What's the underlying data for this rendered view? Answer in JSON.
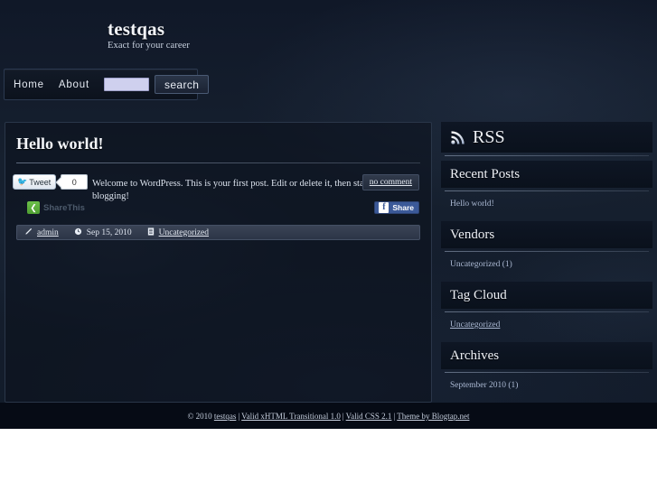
{
  "site": {
    "title": "testqas",
    "tagline": "Exact for your career"
  },
  "nav": {
    "items": [
      {
        "label": "Home"
      },
      {
        "label": "About"
      }
    ],
    "search": {
      "value": "",
      "placeholder": "",
      "button_label": "search"
    }
  },
  "post": {
    "title": "Hello world!",
    "excerpt": "Welcome to WordPress. This is your first post. Edit or delete it, then start blogging!",
    "comments_label": "no comment",
    "meta": {
      "author_icon": "pencil-icon",
      "author": "admin",
      "date_icon": "clock-icon",
      "date": "Sep 15, 2010",
      "category_icon": "document-icon",
      "category": "Uncategorized"
    },
    "social": {
      "tweet_label": "Tweet",
      "tweet_icon": "twitter-bird-icon",
      "tweet_count": "0",
      "sharethis_label": "ShareThis",
      "sharethis_icon": "share-icon",
      "facebook_label": "Share",
      "facebook_icon": "facebook-f-icon"
    }
  },
  "sidebar": {
    "widgets": [
      {
        "name": "rss",
        "title": "RSS",
        "icon": "rss-icon",
        "items": []
      },
      {
        "name": "recent-posts",
        "title": "Recent Posts",
        "items": [
          {
            "label": "Hello world!",
            "underline": false
          }
        ]
      },
      {
        "name": "vendors",
        "title": "Vendors",
        "items": [
          {
            "label": "Uncategorized (1)",
            "underline": false
          }
        ]
      },
      {
        "name": "tag-cloud",
        "title": "Tag Cloud",
        "items": [
          {
            "label": "Uncategorized",
            "underline": true
          }
        ]
      },
      {
        "name": "archives",
        "title": "Archives",
        "items": [
          {
            "label": "September 2010 (1)",
            "underline": false
          }
        ]
      }
    ]
  },
  "footer": {
    "copyright": "© 2010 ",
    "site_link": "testqas",
    "links": [
      "Valid xHTML Transitional 1.0",
      "Valid CSS 2.1",
      "Theme by Blogtap.net"
    ],
    "separator": "|"
  },
  "colors": {
    "background": "#141d2e",
    "panel": "#0b111b",
    "accent_text": "#aab8d2",
    "facebook": "#3b5998",
    "sharethis_green": "#58a834",
    "twitter_blue": "#3aa0d8"
  }
}
